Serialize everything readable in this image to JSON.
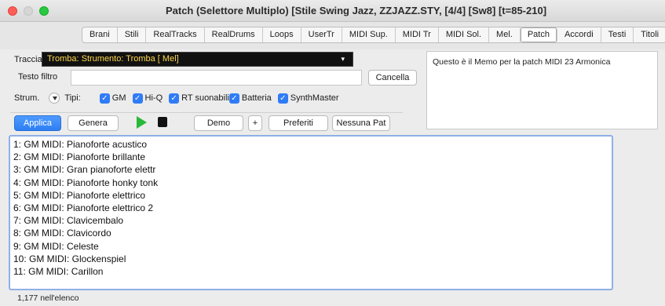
{
  "window": {
    "title": "Patch  (Selettore Multiplo)  [Stile Swing Jazz, ZZJAZZ.STY,  [4/4] [Sw8] [t=85-210]"
  },
  "tabs": [
    {
      "label": "Brani"
    },
    {
      "label": "Stili"
    },
    {
      "label": "RealTracks"
    },
    {
      "label": "RealDrums"
    },
    {
      "label": "Loops"
    },
    {
      "label": "UserTr"
    },
    {
      "label": "MIDI Sup."
    },
    {
      "label": "MIDI Tr"
    },
    {
      "label": "MIDI Sol."
    },
    {
      "label": "Mel."
    },
    {
      "label": "Patch",
      "active": true
    },
    {
      "label": "Accordi"
    },
    {
      "label": "Testi"
    },
    {
      "label": "Titoli"
    }
  ],
  "track": {
    "label": "Traccia",
    "add_symbol": "+",
    "value": "Tromba: Strumento: Tromba [ Mel]",
    "dropdown_arrow": "▾"
  },
  "filter": {
    "label": "Testo filtro",
    "value": "",
    "clear_label": "Cancella"
  },
  "instrument": {
    "label": "Strum.",
    "types_label": "Tipi:",
    "checkboxes": [
      {
        "label": "GM",
        "checked": true
      },
      {
        "label": "Hi-Q",
        "checked": true
      },
      {
        "label": "RT suonabili",
        "checked": true
      },
      {
        "label": "Batteria",
        "checked": true
      },
      {
        "label": "SynthMaster",
        "checked": true
      }
    ]
  },
  "toolbar": {
    "apply_label": "Applica",
    "generate_label": "Genera",
    "demo_label": "Demo",
    "demo_plus": "+",
    "favorites_label": "Preferiti",
    "no_patch_label": "Nessuna Pat"
  },
  "memo": {
    "text": "Questo è il Memo per la patch MIDI 23 Armonica"
  },
  "patches": [
    "1: GM MIDI: Pianoforte acustico",
    "2: GM MIDI: Pianoforte brillante",
    "3: GM MIDI: Gran pianoforte elettr",
    "4: GM MIDI: Pianoforte honky tonk",
    "5: GM MIDI: Pianoforte elettrico",
    "6: GM MIDI: Pianoforte elettrico 2",
    "7: GM MIDI: Clavicembalo",
    "8: GM MIDI: Clavicordo",
    "9: GM MIDI: Celeste",
    "10: GM MIDI: Glockenspiel",
    "11: GM MIDI: Carillon"
  ],
  "status": {
    "count_text": "1,177 nell'elenco"
  },
  "colors": {
    "accent": "#2f7cf6",
    "track_text": "#ffd84a",
    "play": "#28b83a"
  }
}
